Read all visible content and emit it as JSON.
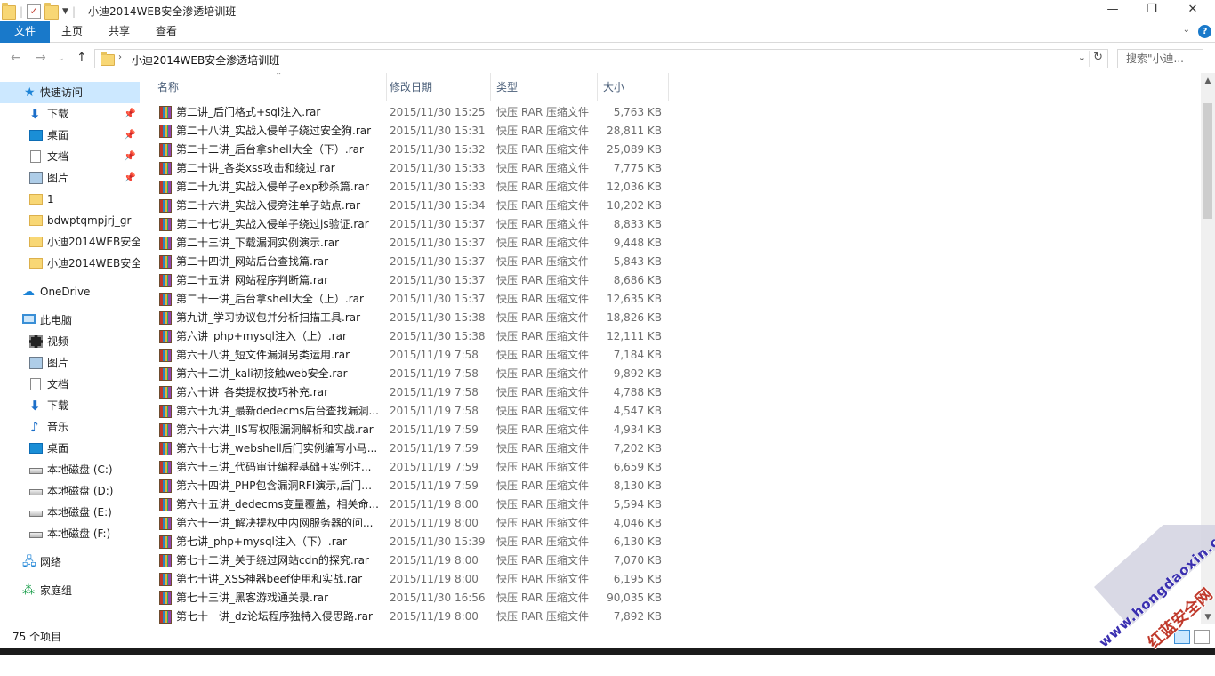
{
  "window": {
    "title": "小迪2014WEB安全渗透培训班",
    "controls": {
      "minimize": "—",
      "maximize": "❐",
      "close": "✕"
    }
  },
  "ribbon": {
    "tabs": [
      "文件",
      "主页",
      "共享",
      "查看"
    ],
    "help": "?"
  },
  "address": {
    "breadcrumb": "小迪2014WEB安全渗透培训班",
    "search_placeholder": "搜索\"小迪...",
    "search_icon": "search-icon"
  },
  "nav": {
    "quick_access": "快速访问",
    "quick_items": [
      {
        "label": "下载",
        "icon": "download-icon",
        "pinned": true
      },
      {
        "label": "桌面",
        "icon": "desktop-icon",
        "pinned": true
      },
      {
        "label": "文档",
        "icon": "document-icon",
        "pinned": true
      },
      {
        "label": "图片",
        "icon": "pictures-icon",
        "pinned": true
      },
      {
        "label": "1",
        "icon": "folder-icon",
        "pinned": false
      },
      {
        "label": "bdwptqmpjrj_gr",
        "icon": "folder-icon",
        "pinned": false
      },
      {
        "label": "小迪2014WEB安全",
        "icon": "folder-icon",
        "pinned": false
      },
      {
        "label": "小迪2014WEB安全",
        "icon": "folder-icon",
        "pinned": false
      }
    ],
    "onedrive": "OneDrive",
    "this_pc": "此电脑",
    "pc_items": [
      {
        "label": "视频",
        "icon": "video-icon"
      },
      {
        "label": "图片",
        "icon": "pictures-icon"
      },
      {
        "label": "文档",
        "icon": "document-icon"
      },
      {
        "label": "下载",
        "icon": "download-icon"
      },
      {
        "label": "音乐",
        "icon": "music-icon"
      },
      {
        "label": "桌面",
        "icon": "desktop-icon"
      },
      {
        "label": "本地磁盘 (C:)",
        "icon": "drive-icon"
      },
      {
        "label": "本地磁盘 (D:)",
        "icon": "drive-icon"
      },
      {
        "label": "本地磁盘 (E:)",
        "icon": "drive-icon"
      },
      {
        "label": "本地磁盘 (F:)",
        "icon": "drive-icon"
      }
    ],
    "network": "网络",
    "homegroup": "家庭组"
  },
  "columns": {
    "name": "名称",
    "date": "修改日期",
    "type": "类型",
    "size": "大小"
  },
  "files": [
    {
      "name": "第二讲_后门格式+sql注入.rar",
      "date": "2015/11/30 15:25",
      "type": "快压 RAR 压缩文件",
      "size": "5,763 KB"
    },
    {
      "name": "第二十八讲_实战入侵单子绕过安全狗.rar",
      "date": "2015/11/30 15:31",
      "type": "快压 RAR 压缩文件",
      "size": "28,811 KB"
    },
    {
      "name": "第二十二讲_后台拿shell大全（下）.rar",
      "date": "2015/11/30 15:32",
      "type": "快压 RAR 压缩文件",
      "size": "25,089 KB"
    },
    {
      "name": "第二十讲_各类xss攻击和绕过.rar",
      "date": "2015/11/30 15:33",
      "type": "快压 RAR 压缩文件",
      "size": "7,775 KB"
    },
    {
      "name": "第二十九讲_实战入侵单子exp秒杀篇.rar",
      "date": "2015/11/30 15:33",
      "type": "快压 RAR 压缩文件",
      "size": "12,036 KB"
    },
    {
      "name": "第二十六讲_实战入侵旁注单子站点.rar",
      "date": "2015/11/30 15:34",
      "type": "快压 RAR 压缩文件",
      "size": "10,202 KB"
    },
    {
      "name": "第二十七讲_实战入侵单子绕过js验证.rar",
      "date": "2015/11/30 15:37",
      "type": "快压 RAR 压缩文件",
      "size": "8,833 KB"
    },
    {
      "name": "第二十三讲_下载漏洞实例演示.rar",
      "date": "2015/11/30 15:37",
      "type": "快压 RAR 压缩文件",
      "size": "9,448 KB"
    },
    {
      "name": "第二十四讲_网站后台查找篇.rar",
      "date": "2015/11/30 15:37",
      "type": "快压 RAR 压缩文件",
      "size": "5,843 KB"
    },
    {
      "name": "第二十五讲_网站程序判断篇.rar",
      "date": "2015/11/30 15:37",
      "type": "快压 RAR 压缩文件",
      "size": "8,686 KB"
    },
    {
      "name": "第二十一讲_后台拿shell大全（上）.rar",
      "date": "2015/11/30 15:37",
      "type": "快压 RAR 压缩文件",
      "size": "12,635 KB"
    },
    {
      "name": "第九讲_学习协议包并分析扫描工具.rar",
      "date": "2015/11/30 15:38",
      "type": "快压 RAR 压缩文件",
      "size": "18,826 KB"
    },
    {
      "name": "第六讲_php+mysql注入（上）.rar",
      "date": "2015/11/30 15:38",
      "type": "快压 RAR 压缩文件",
      "size": "12,111 KB"
    },
    {
      "name": "第六十八讲_短文件漏洞另类运用.rar",
      "date": "2015/11/19 7:58",
      "type": "快压 RAR 压缩文件",
      "size": "7,184 KB"
    },
    {
      "name": "第六十二讲_kali初接触web安全.rar",
      "date": "2015/11/19 7:58",
      "type": "快压 RAR 压缩文件",
      "size": "9,892 KB"
    },
    {
      "name": "第六十讲_各类提权技巧补充.rar",
      "date": "2015/11/19 7:58",
      "type": "快压 RAR 压缩文件",
      "size": "4,788 KB"
    },
    {
      "name": "第六十九讲_最新dedecms后台查找漏洞...",
      "date": "2015/11/19 7:58",
      "type": "快压 RAR 压缩文件",
      "size": "4,547 KB"
    },
    {
      "name": "第六十六讲_IIS写权限漏洞解析和实战.rar",
      "date": "2015/11/19 7:59",
      "type": "快压 RAR 压缩文件",
      "size": "4,934 KB"
    },
    {
      "name": "第六十七讲_webshell后门实例编写小马...",
      "date": "2015/11/19 7:59",
      "type": "快压 RAR 压缩文件",
      "size": "7,202 KB"
    },
    {
      "name": "第六十三讲_代码审计编程基础+实例注...",
      "date": "2015/11/19 7:59",
      "type": "快压 RAR 压缩文件",
      "size": "6,659 KB"
    },
    {
      "name": "第六十四讲_PHP包含漏洞RFI演示,后门包...",
      "date": "2015/11/19 7:59",
      "type": "快压 RAR 压缩文件",
      "size": "8,130 KB"
    },
    {
      "name": "第六十五讲_dedecms变量覆盖，相关命...",
      "date": "2015/11/19 8:00",
      "type": "快压 RAR 压缩文件",
      "size": "5,594 KB"
    },
    {
      "name": "第六十一讲_解决提权中内网服务器的问...",
      "date": "2015/11/19 8:00",
      "type": "快压 RAR 压缩文件",
      "size": "4,046 KB"
    },
    {
      "name": "第七讲_php+mysql注入（下）.rar",
      "date": "2015/11/30 15:39",
      "type": "快压 RAR 压缩文件",
      "size": "6,130 KB"
    },
    {
      "name": "第七十二讲_关于绕过网站cdn的探究.rar",
      "date": "2015/11/19 8:00",
      "type": "快压 RAR 压缩文件",
      "size": "7,070 KB"
    },
    {
      "name": "第七十讲_XSS神器beef使用和实战.rar",
      "date": "2015/11/19 8:00",
      "type": "快压 RAR 压缩文件",
      "size": "6,195 KB"
    },
    {
      "name": "第七十三讲_黑客游戏通关录.rar",
      "date": "2015/11/30 16:56",
      "type": "快压 RAR 压缩文件",
      "size": "90,035 KB"
    },
    {
      "name": "第七十一讲_dz论坛程序独特入侵思路.rar",
      "date": "2015/11/19 8:00",
      "type": "快压 RAR 压缩文件",
      "size": "7,892 KB"
    }
  ],
  "status": {
    "item_count": "75 个项目"
  },
  "watermark": {
    "line1": "www.hongdaoxin.com",
    "line2": "红蓝安全网"
  },
  "colors": {
    "accent": "#1979ca",
    "selected": "#cce8ff",
    "header_text": "#4c607a"
  }
}
